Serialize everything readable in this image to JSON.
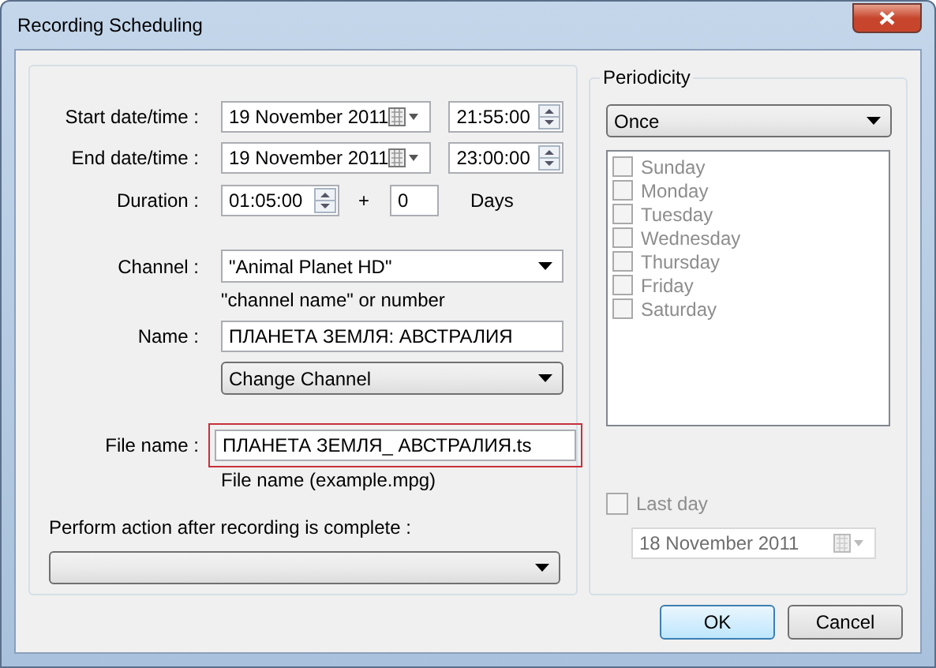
{
  "window": {
    "title": "Recording Scheduling"
  },
  "schedule": {
    "start": {
      "label": "Start date/time :",
      "date": "19 November 2011",
      "time": "21:55:00"
    },
    "end": {
      "label": "End date/time :",
      "date": "19 November 2011",
      "time": "23:00:00"
    },
    "duration": {
      "label": "Duration :",
      "value": "01:05:00",
      "plus": "+",
      "days": "0",
      "days_label": "Days"
    }
  },
  "channel": {
    "label": "Channel :",
    "value": "\"Animal Planet HD\"",
    "hint": "\"channel name\" or number"
  },
  "name": {
    "label": "Name :",
    "value": "ПЛАНЕТА ЗЕМЛЯ: АВСТРАЛИЯ",
    "action": "Change Channel"
  },
  "file": {
    "label": "File name :",
    "value": "ПЛАНЕТА ЗЕМЛЯ_ АВСТРАЛИЯ.ts",
    "hint": "File name (example.mpg)",
    "highlighted": true
  },
  "after": {
    "label": "Perform action after recording is complete :"
  },
  "periodicity": {
    "title": "Periodicity",
    "value": "Once",
    "days": [
      {
        "label": "Sunday",
        "checked": false,
        "disabled": true
      },
      {
        "label": "Monday",
        "checked": false,
        "disabled": true
      },
      {
        "label": "Tuesday",
        "checked": false,
        "disabled": true
      },
      {
        "label": "Wednesday",
        "checked": false,
        "disabled": true
      },
      {
        "label": "Thursday",
        "checked": false,
        "disabled": true
      },
      {
        "label": "Friday",
        "checked": false,
        "disabled": true
      },
      {
        "label": "Saturday",
        "checked": false,
        "disabled": true
      }
    ],
    "last_day": {
      "label": "Last day",
      "checked": false,
      "disabled": true,
      "date": "18 November 2011"
    }
  },
  "buttons": [
    {
      "label": "OK",
      "default": true
    },
    {
      "label": "Cancel",
      "default": false
    }
  ]
}
